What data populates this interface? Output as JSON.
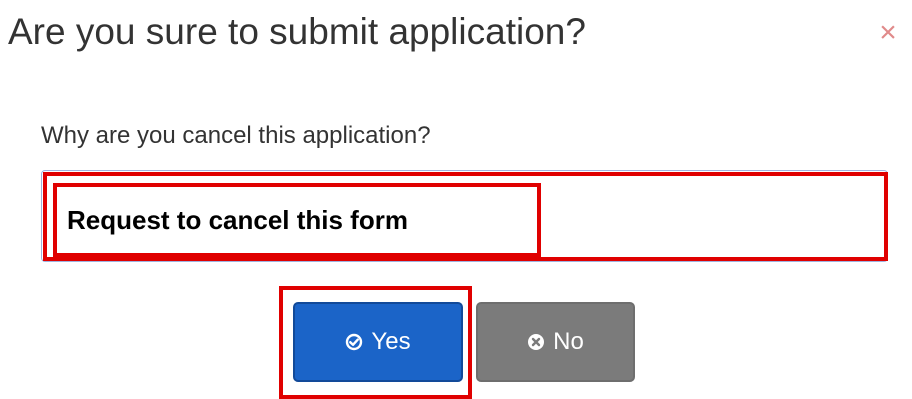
{
  "dialog": {
    "title": "Are you sure to submit application?",
    "close_icon": "close-icon",
    "close_glyph": "×",
    "close_color": "#e08a8a"
  },
  "form": {
    "question": "Why are you cancel this application?",
    "reason_value": "Request to cancel this form"
  },
  "actions": {
    "yes_label": "Yes",
    "yes_icon": "check-circle-icon",
    "yes_color": "#1b64c8",
    "no_label": "No",
    "no_icon": "times-circle-icon",
    "no_color": "#7b7b7b"
  },
  "annotations": {
    "highlight_color": "#e00000"
  }
}
